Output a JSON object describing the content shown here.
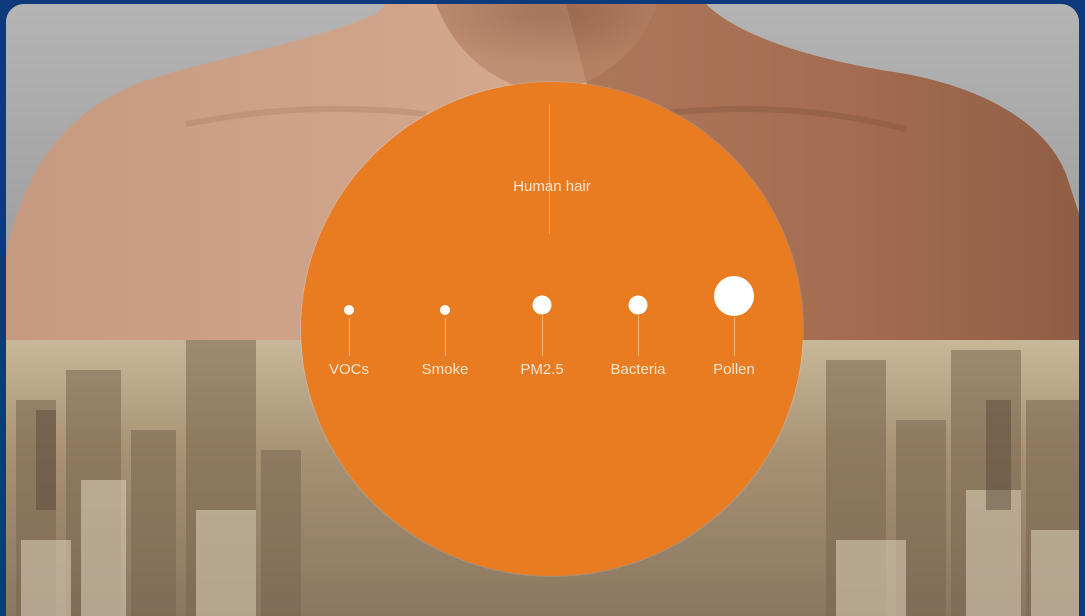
{
  "diagram": {
    "hair_label": "Human hair",
    "particles": [
      {
        "label": "VOCs"
      },
      {
        "label": "Smoke"
      },
      {
        "label": "PM2.5"
      },
      {
        "label": "Bacteria"
      },
      {
        "label": "Pollen"
      }
    ]
  },
  "colors": {
    "accent": "#e97b21",
    "border": "#0d3a7a",
    "label_text": "#fde6cf"
  }
}
